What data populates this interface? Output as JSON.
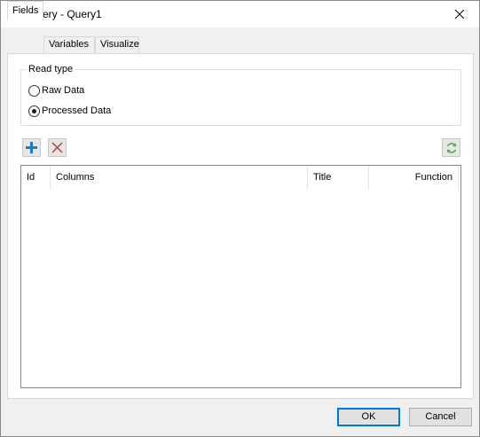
{
  "window": {
    "title": "Query - Query1",
    "icon": "table-icon",
    "close_icon": "close-icon"
  },
  "tabs": [
    {
      "label": "Fields",
      "active": true
    },
    {
      "label": "Variables",
      "active": false
    },
    {
      "label": "Visualize",
      "active": false
    }
  ],
  "read_type": {
    "legend": "Read type",
    "options": [
      {
        "label": "Raw Data",
        "checked": false
      },
      {
        "label": "Processed Data",
        "checked": true
      }
    ]
  },
  "toolbar": {
    "add_icon": "plus-icon",
    "delete_icon": "delete-x-icon",
    "refresh_icon": "refresh-icon"
  },
  "list": {
    "columns": [
      "Id",
      "Columns",
      "Title",
      "Function"
    ],
    "rows": []
  },
  "footer": {
    "ok_label": "OK",
    "cancel_label": "Cancel"
  },
  "colors": {
    "accent": "#0078d7",
    "add_icon": "#1e7ac4",
    "delete_icon": "#c0504d",
    "refresh_icon": "#4caf50"
  }
}
